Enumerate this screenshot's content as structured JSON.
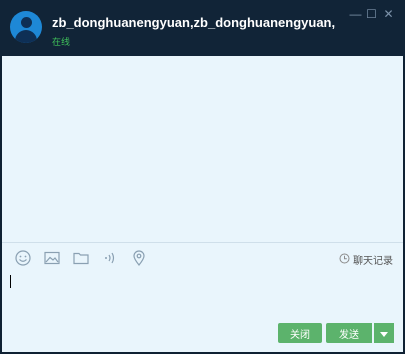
{
  "header": {
    "contact_name": "zb_donghuanengyuan,zb_donghuanengyuan,",
    "status": "在线"
  },
  "window_controls": {
    "minimize": "—",
    "maximize": "☐",
    "close": "✕"
  },
  "toolbar": {
    "icons": [
      "emoji-icon",
      "image-icon",
      "folder-icon",
      "voice-icon",
      "location-icon"
    ],
    "history_label": "聊天记录"
  },
  "actions": {
    "close_label": "关闭",
    "send_label": "发送"
  },
  "colors": {
    "titlebar": "#112437",
    "content_bg": "#e9f5fc",
    "status_green": "#3fc15a",
    "button_green": "#5cb36c",
    "avatar_blue": "#1e88d6"
  }
}
